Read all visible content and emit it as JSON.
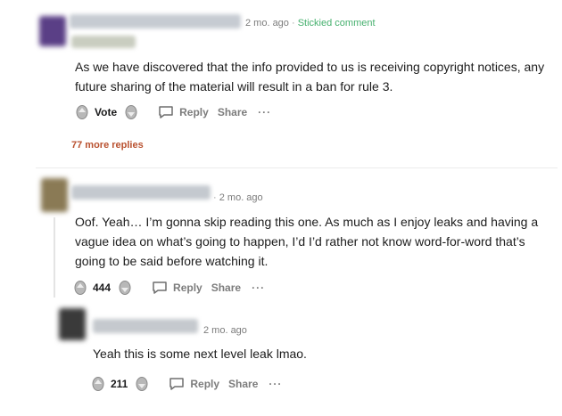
{
  "comments": [
    {
      "time": "2 mo. ago",
      "sep": "·",
      "sticky": "Stickied comment",
      "body": "As we have discovered that the info provided to us is receiving copyright notices, any future sharing of the material will result in a ban for rule 3.",
      "vote_label": "Vote",
      "reply_label": "Reply",
      "share_label": "Share",
      "more_label": "···"
    },
    {
      "time": "2 mo. ago",
      "sep": "·",
      "body": "Oof. Yeah… I’m gonna skip reading this one. As much as I enjoy leaks and having a vague idea on what’s going to happen, I’d I’d rather not know word-for-word that’s going to be said before watching it.",
      "vote_label": "444",
      "reply_label": "Reply",
      "share_label": "Share",
      "more_label": "···"
    },
    {
      "time": "2 mo. ago",
      "body": "Yeah this is some next level leak lmao.",
      "vote_label": "211",
      "reply_label": "Reply",
      "share_label": "Share",
      "more_label": "···"
    }
  ],
  "more_replies": "77 more replies",
  "icons": {
    "upvote": "upvote-icon",
    "downvote": "downvote-icon",
    "reply": "reply-icon",
    "more": "more-icon"
  },
  "colors": {
    "stickied": "#46b06e",
    "more_replies": "#b9512f",
    "meta": "#7c7c7c"
  }
}
